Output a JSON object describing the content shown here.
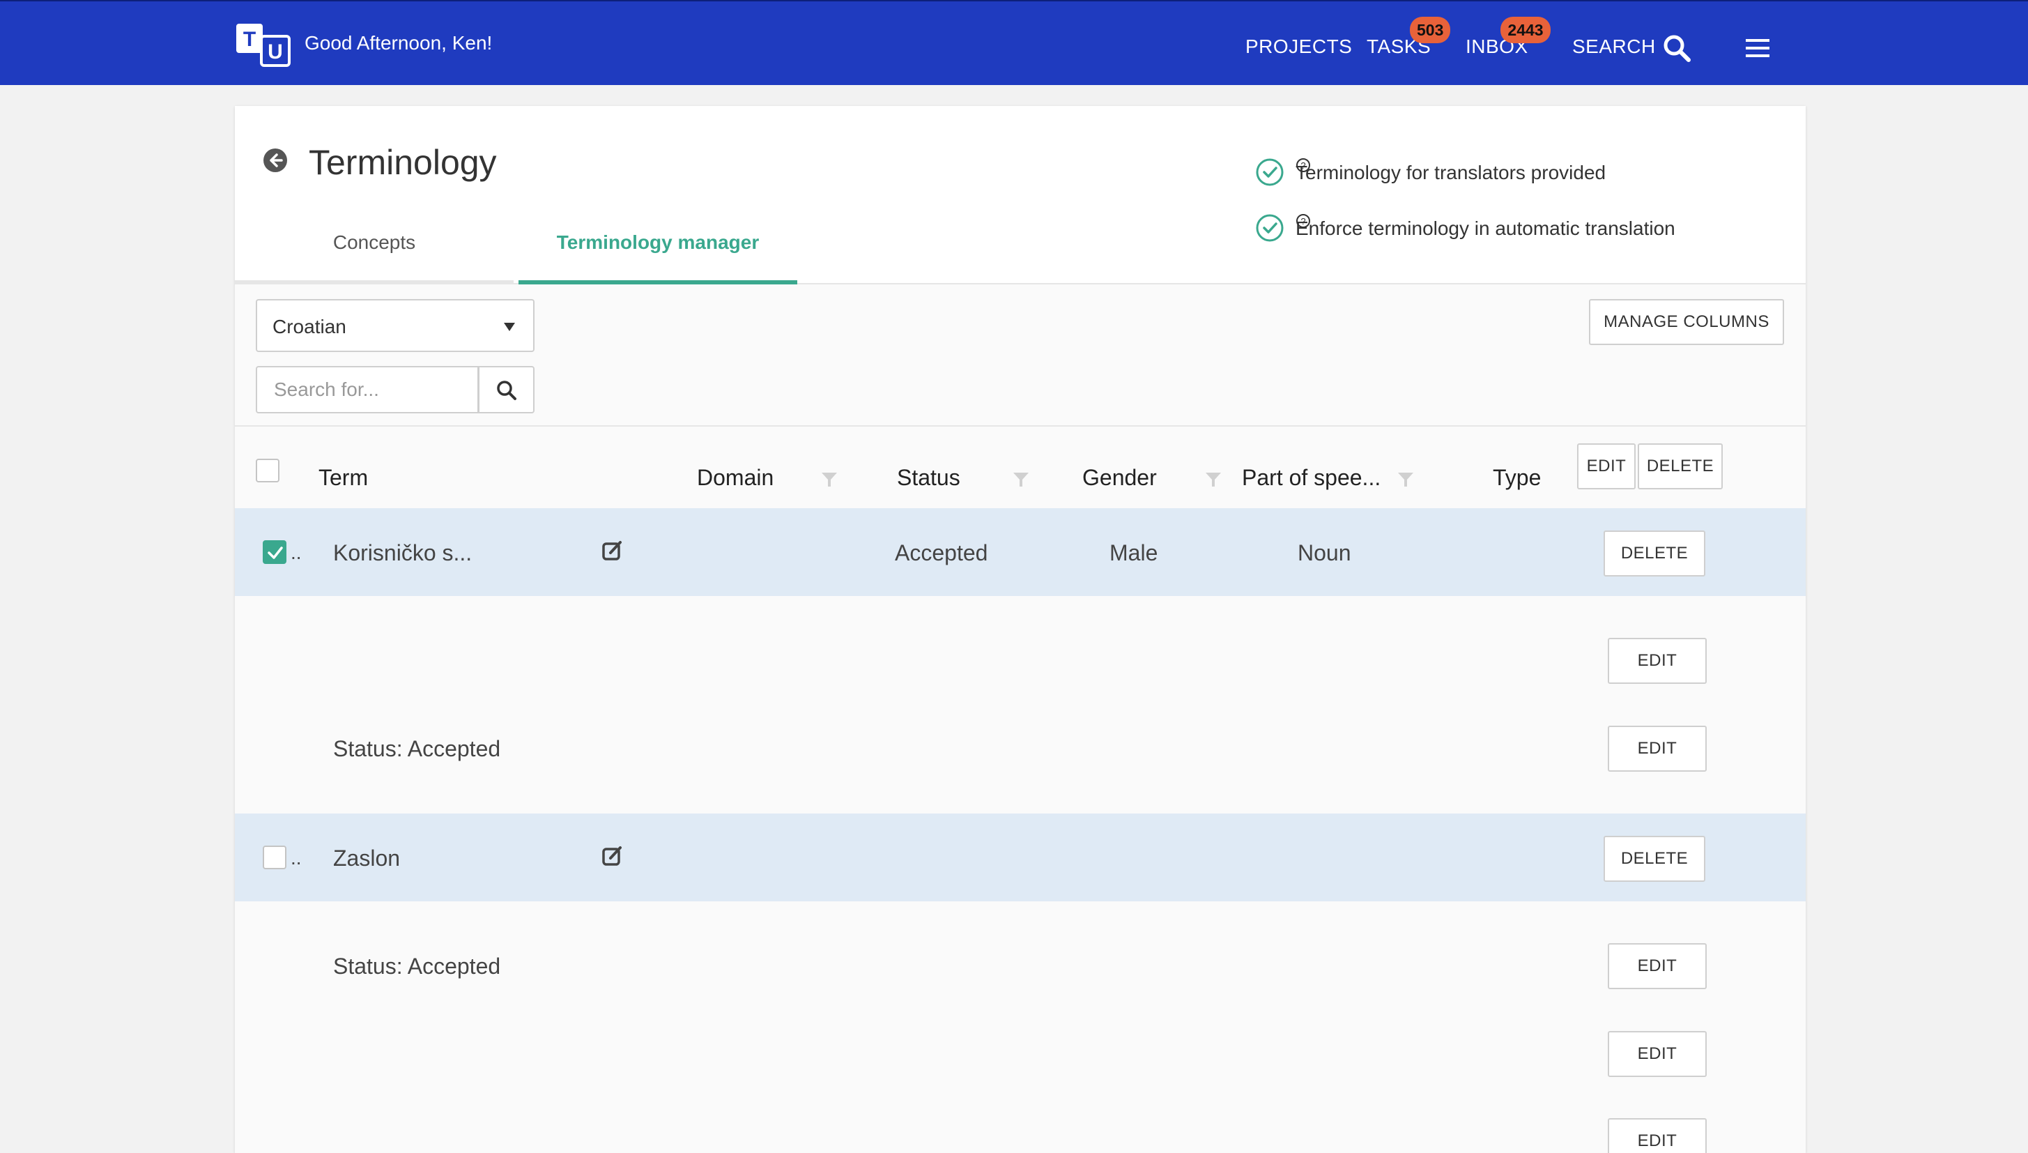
{
  "header": {
    "logo_text": "TU",
    "greeting": "Good Afternoon, Ken!",
    "nav": {
      "projects": "PROJECTS",
      "tasks": "TASKS",
      "tasks_badge": "503",
      "inbox": "INBOX",
      "inbox_badge": "2443",
      "search": "SEARCH"
    },
    "colors": {
      "bar": "#1f3bbf",
      "badge": "#e8623a"
    }
  },
  "page": {
    "title": "Terminology",
    "options": [
      {
        "label": "Terminology for translators provided",
        "checked": true
      },
      {
        "label": "Enforce terminology in automatic translation",
        "checked": true
      }
    ],
    "tabs": [
      {
        "label": "Concepts",
        "active": false
      },
      {
        "label": "Terminology manager",
        "active": true
      }
    ],
    "accent_color": "#3aa88e"
  },
  "toolbar": {
    "language_select": "Croatian",
    "search_placeholder": "Search for...",
    "manage_columns": "MANAGE COLUMNS"
  },
  "table": {
    "columns": [
      "Term",
      "Domain",
      "Status",
      "Gender",
      "Part of spee...",
      "Type"
    ],
    "header_actions": {
      "edit": "EDIT",
      "delete": "DELETE"
    },
    "rows": [
      {
        "checked": true,
        "dots": "..",
        "term": "Korisničko s...",
        "status": "Accepted",
        "gender": "Male",
        "part_of_speech": "Noun",
        "delete": "DELETE",
        "details": [
          {
            "text": "",
            "edit": "EDIT"
          },
          {
            "text": "Status: Accepted",
            "edit": "EDIT"
          }
        ]
      },
      {
        "checked": false,
        "dots": "..",
        "term": "Zaslon",
        "delete": "DELETE",
        "details": [
          {
            "text": "Status: Accepted",
            "edit": "EDIT"
          },
          {
            "text": "",
            "edit": "EDIT"
          },
          {
            "text": "",
            "edit": "EDIT"
          }
        ]
      }
    ]
  }
}
